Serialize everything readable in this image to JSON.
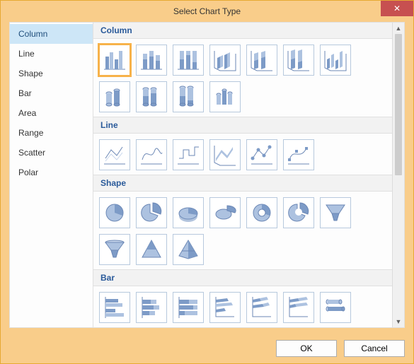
{
  "title": "Select Chart Type",
  "close_glyph": "✕",
  "sidebar": {
    "items": [
      {
        "label": "Column",
        "selected": true
      },
      {
        "label": "Line",
        "selected": false
      },
      {
        "label": "Shape",
        "selected": false
      },
      {
        "label": "Bar",
        "selected": false
      },
      {
        "label": "Area",
        "selected": false
      },
      {
        "label": "Range",
        "selected": false
      },
      {
        "label": "Scatter",
        "selected": false
      },
      {
        "label": "Polar",
        "selected": false
      }
    ]
  },
  "sections": {
    "column": {
      "label": "Column"
    },
    "line": {
      "label": "Line"
    },
    "shape": {
      "label": "Shape"
    },
    "bar": {
      "label": "Bar"
    }
  },
  "tiles": {
    "column": [
      {
        "name": "clustered-column-2d",
        "selected": true
      },
      {
        "name": "stacked-column-2d",
        "selected": false
      },
      {
        "name": "100pct-stacked-column-2d",
        "selected": false
      },
      {
        "name": "clustered-column-3d",
        "selected": false
      },
      {
        "name": "stacked-column-3d",
        "selected": false
      },
      {
        "name": "100pct-stacked-column-3d",
        "selected": false
      },
      {
        "name": "column-3d",
        "selected": false
      },
      {
        "name": "clustered-cylinder",
        "selected": false
      },
      {
        "name": "stacked-cylinder",
        "selected": false
      },
      {
        "name": "100pct-stacked-cylinder",
        "selected": false
      },
      {
        "name": "cylinder-3d",
        "selected": false
      }
    ],
    "line": [
      {
        "name": "line"
      },
      {
        "name": "spline"
      },
      {
        "name": "step-line"
      },
      {
        "name": "line-3d"
      },
      {
        "name": "line-with-markers"
      },
      {
        "name": "spline-with-markers"
      }
    ],
    "shape": [
      {
        "name": "pie-2d"
      },
      {
        "name": "pie-exploded-2d"
      },
      {
        "name": "pie-3d"
      },
      {
        "name": "pie-exploded-3d"
      },
      {
        "name": "doughnut"
      },
      {
        "name": "doughnut-exploded"
      },
      {
        "name": "funnel"
      },
      {
        "name": "funnel-3d"
      },
      {
        "name": "pyramid"
      },
      {
        "name": "pyramid-3d"
      }
    ],
    "bar": [
      {
        "name": "clustered-bar-2d"
      },
      {
        "name": "stacked-bar-2d"
      },
      {
        "name": "100pct-stacked-bar-2d"
      },
      {
        "name": "clustered-bar-3d"
      },
      {
        "name": "stacked-bar-3d"
      },
      {
        "name": "100pct-stacked-bar-3d"
      },
      {
        "name": "bar-3d"
      }
    ]
  },
  "footer": {
    "ok_label": "OK",
    "cancel_label": "Cancel"
  }
}
